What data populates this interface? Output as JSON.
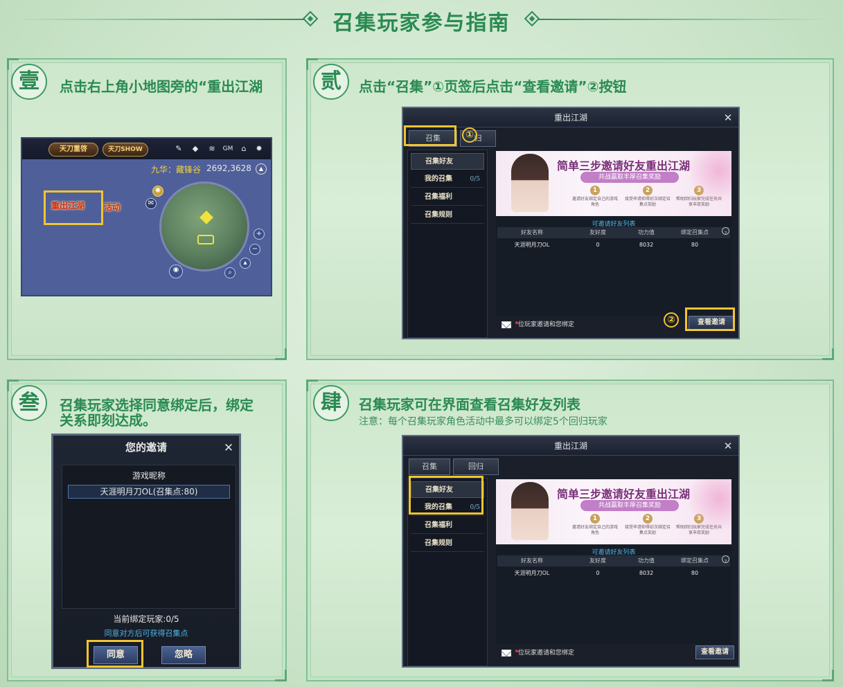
{
  "title": "召集玩家参与指南",
  "panels": {
    "p1": {
      "badge": "壹",
      "text": "点击右上角小地图旁的“重出江湖",
      "hud": {
        "logo1": "天刀重啓",
        "logo2": "天刀SHOW",
        "gm": "GM",
        "location": "九华：藏锋谷",
        "coords": "2692,3628",
        "event1": "重出江湖",
        "event2": "活动"
      }
    },
    "p2": {
      "badge": "贰",
      "text": "点击“召集”①页签后点击“查看邀请”②按钮"
    },
    "p3": {
      "badge": "叁",
      "text_line1": "召集玩家选择同意绑定后，绑定",
      "text_line2": "关系即刻达成。",
      "dialog": {
        "title": "您的邀请",
        "column": "游戏昵称",
        "row": "天涯明月刀OL(召集点:80)",
        "count": "当前绑定玩家:0/5",
        "hint": "同意对方后可获得召集点",
        "agree": "同意",
        "ignore": "忽略"
      }
    },
    "p4": {
      "badge": "肆",
      "text": "召集玩家可在界面查看召集好友列表",
      "note": "注意：每个召集玩家角色活动中最多可以绑定5个回归玩家"
    }
  },
  "gamewin": {
    "title": "重出江湖",
    "tab_summon": "召集",
    "tab_return": "回归",
    "tab_return_partial": "归",
    "sidebar": [
      "召集好友",
      "我的召集",
      "召集福利",
      "召集规则"
    ],
    "my_count": "0/5",
    "banner_title": "简单三步邀请好友重出江湖",
    "banner_sub": "共战赢取丰厚召集奖励",
    "banner_steps": [
      {
        "num": "1",
        "text": "邀请好友绑定自己的游戏角色"
      },
      {
        "num": "2",
        "text": "接受申请抑得初次绑定召集点奖励"
      },
      {
        "num": "3",
        "text": "帮助回归玩家完成任务共享丰厚奖励"
      }
    ],
    "table_caption": "可邀请好友列表",
    "headers": [
      "好友名称",
      "友好度",
      "功力值",
      "绑定召集点"
    ],
    "help": "?",
    "row": [
      "天涯明月刀OL",
      "0",
      "8032",
      "80"
    ],
    "footer": "位玩家邀请和您绑定",
    "view_btn": "查看邀请",
    "num1": "①",
    "num2": "②"
  }
}
